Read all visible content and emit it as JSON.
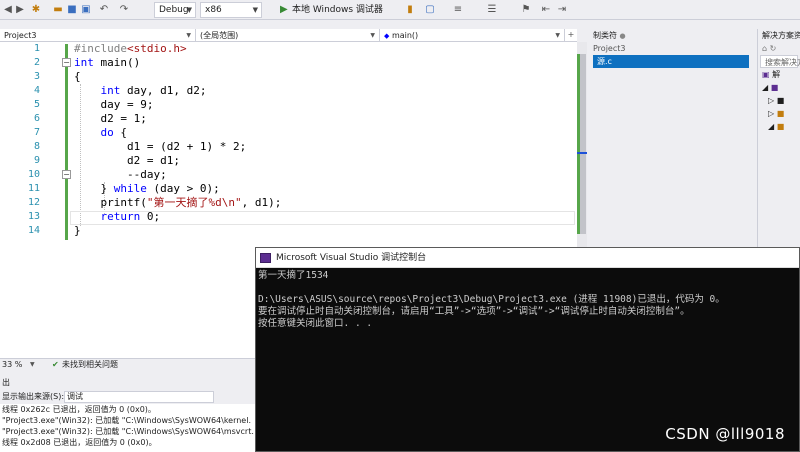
{
  "toolbar": {
    "config": "Debug",
    "platform": "x86",
    "run_label": "本地 Windows 调试器"
  },
  "editor": {
    "project_combo": "Project3",
    "scope_combo": "(全局范围)",
    "function_combo": "main()",
    "line_numbers": [
      "1",
      "2",
      "3",
      "4",
      "5",
      "6",
      "7",
      "8",
      "9",
      "10",
      "11",
      "12",
      "13",
      "14"
    ],
    "zoom": "33 %",
    "status": "未找到相关问题"
  },
  "output": {
    "title": "出",
    "source_label": "显示输出来源(S):",
    "source_value": "调试",
    "lines": [
      "线程 0x262c 已退出，返回值为 0 (0x0)。",
      "\"Project3.exe\"(Win32): 已加载 \"C:\\Windows\\SysWOW64\\kernel.",
      "\"Project3.exe\"(Win32): 已加载 \"C:\\Windows\\SysWOW64\\msvcrt.",
      "线程 0x2d08 已退出，返回值为 0 (0x0)。"
    ]
  },
  "class_view": {
    "title": "制类符",
    "project": "Project3",
    "selected_item": "源.c"
  },
  "solution_explorer": {
    "title": "解决方案资源",
    "search_placeholder": "搜索解决方",
    "root_label": "解"
  },
  "console": {
    "title": "Microsoft Visual Studio 调试控制台",
    "lines": [
      "第一天摘了1534",
      "",
      "D:\\Users\\ASUS\\source\\repos\\Project3\\Debug\\Project3.exe (进程 11908)已退出，代码为 0。",
      "要在调试停止时自动关闭控制台，请启用“工具”->“选项”->“调试”->“调试停止时自动关闭控制台”。",
      "按任意键关闭此窗口. . ."
    ]
  },
  "watermark": "CSDN @lll9018",
  "colors": {
    "keyword": "#0000ff",
    "string": "#a31515",
    "line_number": "#2b91af",
    "selection": "#0e70c0"
  }
}
